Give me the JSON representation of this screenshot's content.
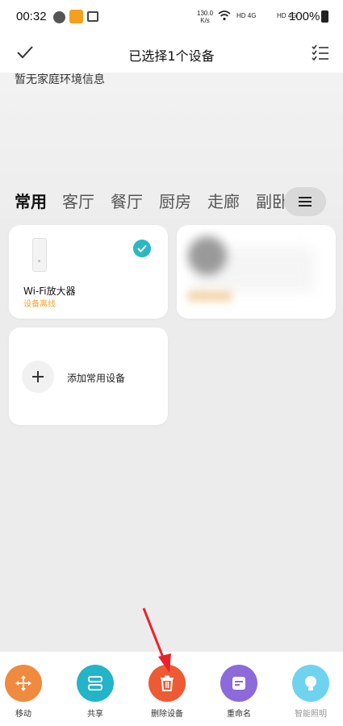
{
  "status_bar": {
    "time": "00:32",
    "speed_value": "130.0",
    "speed_unit": "K/s",
    "network_a": "HD 4G",
    "network_b": "HD 4G",
    "battery": "100%"
  },
  "top_bar": {
    "title": "已选择1个设备"
  },
  "header": {
    "home_info": "暂无家庭环境信息"
  },
  "room_tabs": [
    {
      "label": "常用",
      "active": true
    },
    {
      "label": "客厅",
      "active": false
    },
    {
      "label": "餐厅",
      "active": false
    },
    {
      "label": "厨房",
      "active": false
    },
    {
      "label": "走廊",
      "active": false
    },
    {
      "label": "副卧",
      "active": false
    }
  ],
  "devices": [
    {
      "name": "Wi-Fi放大器",
      "status": "设备离线",
      "selected": true
    }
  ],
  "add_device_label": "添加常用设备",
  "actions": {
    "move": "移动",
    "share": "共享",
    "delete": "删除设备",
    "rename": "重命名",
    "light": "智能照明"
  },
  "colors": {
    "accent_teal": "#2db7c4",
    "offline_orange": "#f0a431",
    "move": "#f08a3e",
    "share": "#23b4c8",
    "delete": "#ee5a33",
    "rename": "#8c6ad9",
    "light": "#6fd3f0"
  }
}
